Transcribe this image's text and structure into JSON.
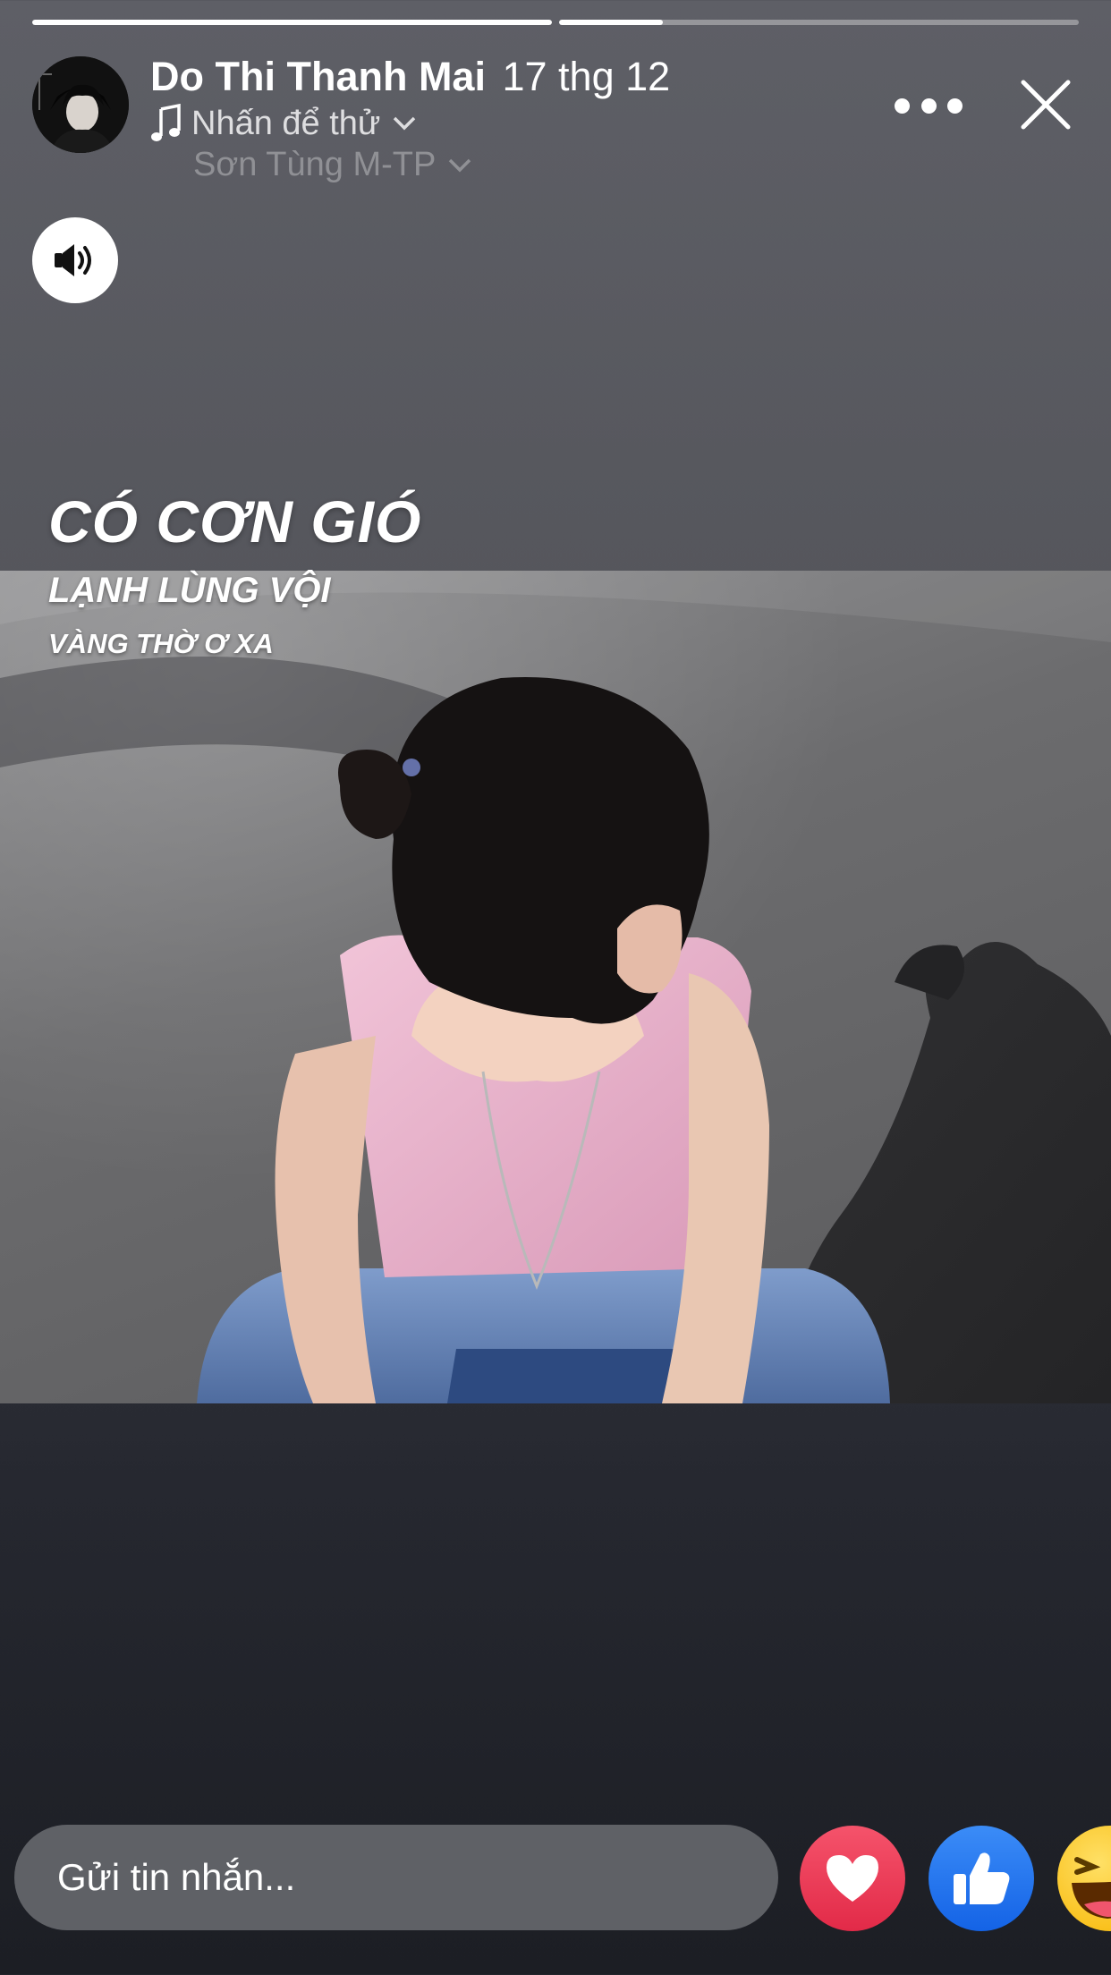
{
  "story": {
    "progress": [
      1.0,
      0.2
    ],
    "author_name": "Do Thi Thanh Mai",
    "date": "17 thg 12",
    "music_label": "Nhấn để thử",
    "artist": "Sơn Tùng M-TP"
  },
  "lyrics": {
    "line1": "CÓ CƠN GIÓ",
    "line2": "LẠNH LÙNG VỘI",
    "line3": "VÀNG THỜ Ơ XA"
  },
  "footer": {
    "message_placeholder": "Gửi tin nhắn..."
  },
  "icons": {
    "music": "music-note-icon",
    "more": "more-icon",
    "close": "close-icon",
    "sound": "speaker-icon",
    "heart": "heart-icon",
    "like": "like-icon",
    "haha": "haha-icon"
  },
  "colors": {
    "heart": "#e22a48",
    "like": "#1463e6",
    "haha": "#f7b500"
  }
}
